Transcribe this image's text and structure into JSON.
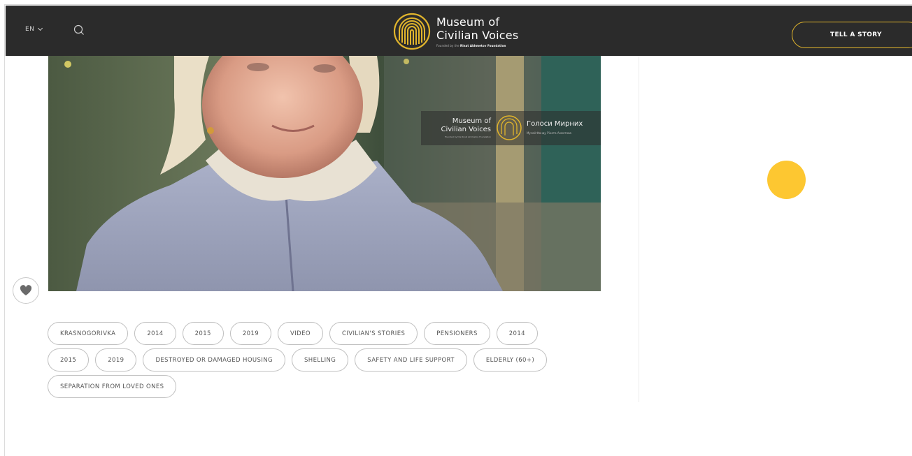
{
  "header": {
    "language": "EN",
    "logo": {
      "line1": "Museum of",
      "line2": "Civilian Voices",
      "sub_prefix": "Founded by the",
      "sub_brand": "Rinat Akhmetov Foundation"
    },
    "cta_label": "TELL A STORY"
  },
  "video": {
    "watermark": {
      "left_line1": "Museum of",
      "left_line2": "Civilian Voices",
      "left_sub": "Founded by the Rinat Akhmetov Foundation",
      "right_line1": "Голоси Мирних",
      "right_sub": "Музей Фонду Ріната Ахметова"
    }
  },
  "tags": [
    [
      "KRASNOGORIVKA",
      "2014",
      "2015",
      "2019",
      "VIDEO",
      "CIVILIAN'S STORIES",
      "PENSIONERS",
      "2014"
    ],
    [
      "2015",
      "2019",
      "DESTROYED OR DAMAGED HOUSING",
      "SHELLING",
      "SAFETY AND LIFE SUPPORT",
      "ELDERLY (60+)"
    ],
    [
      "SEPARATION FROM LOVED ONES"
    ]
  ],
  "colors": {
    "header_bg": "#2b2b2b",
    "accent": "#e1b52c",
    "dot": "#fdc731"
  },
  "icons": [
    "chevron-down-icon",
    "search-icon",
    "fingerprint-logo-icon",
    "heart-icon"
  ]
}
